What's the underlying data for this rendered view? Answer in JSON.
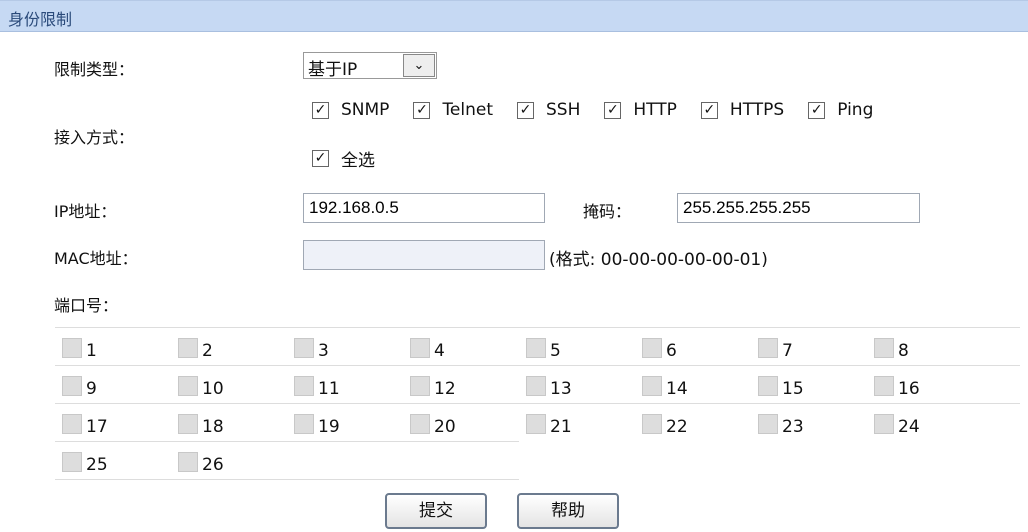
{
  "header": {
    "title": "身份限制"
  },
  "restrict_type": {
    "label": "限制类型：",
    "value": "基于IP"
  },
  "access": {
    "label": "接入方式：",
    "options": [
      {
        "label": "SNMP",
        "checked": true
      },
      {
        "label": "Telnet",
        "checked": true
      },
      {
        "label": "SSH",
        "checked": true
      },
      {
        "label": "HTTP",
        "checked": true
      },
      {
        "label": "HTTPS",
        "checked": true
      },
      {
        "label": "Ping",
        "checked": true
      }
    ],
    "select_all": {
      "label": "全选",
      "checked": true
    }
  },
  "ip": {
    "label": "IP地址：",
    "value": "192.168.0.5"
  },
  "mask": {
    "label": "掩码：",
    "value": "255.255.255.255"
  },
  "mac": {
    "label": "MAC地址：",
    "value": "",
    "hint": "(格式: 00-00-00-00-00-01)"
  },
  "ports": {
    "label": "端口号：",
    "items": [
      "1",
      "2",
      "3",
      "4",
      "5",
      "6",
      "7",
      "8",
      "9",
      "10",
      "11",
      "12",
      "13",
      "14",
      "15",
      "16",
      "17",
      "18",
      "19",
      "20",
      "21",
      "22",
      "23",
      "24",
      "25",
      "26"
    ]
  },
  "buttons": {
    "submit": "提交",
    "help": "帮助"
  }
}
